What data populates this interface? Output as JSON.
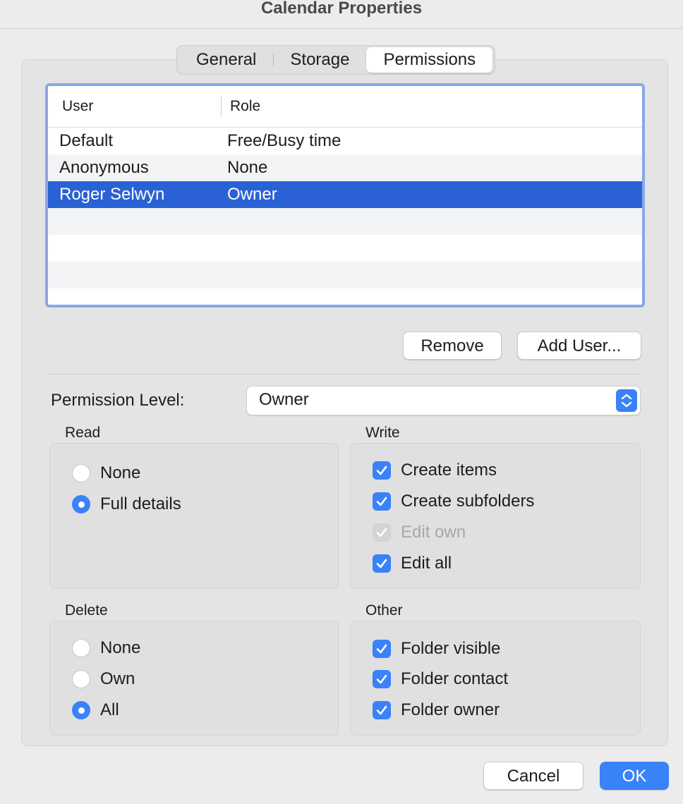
{
  "window": {
    "title": "Calendar Properties"
  },
  "tabs": [
    {
      "label": "General",
      "active": false
    },
    {
      "label": "Storage",
      "active": false
    },
    {
      "label": "Permissions",
      "active": true
    }
  ],
  "users_table": {
    "columns": [
      "User",
      "Role"
    ],
    "rows": [
      {
        "user": "Default",
        "role": "Free/Busy time",
        "selected": false
      },
      {
        "user": "Anonymous",
        "role": "None",
        "selected": false
      },
      {
        "user": "Roger Selwyn",
        "role": "Owner",
        "selected": true
      }
    ]
  },
  "buttons": {
    "remove": "Remove",
    "add_user": "Add User...",
    "cancel": "Cancel",
    "ok": "OK"
  },
  "permission_level": {
    "label": "Permission Level:",
    "value": "Owner"
  },
  "read": {
    "label": "Read",
    "options": [
      {
        "label": "None",
        "selected": false
      },
      {
        "label": "Full details",
        "selected": true
      }
    ]
  },
  "write": {
    "label": "Write",
    "options": [
      {
        "label": "Create items",
        "checked": true,
        "disabled": false
      },
      {
        "label": "Create subfolders",
        "checked": true,
        "disabled": false
      },
      {
        "label": "Edit own",
        "checked": true,
        "disabled": true
      },
      {
        "label": "Edit all",
        "checked": true,
        "disabled": false
      }
    ]
  },
  "delete": {
    "label": "Delete",
    "options": [
      {
        "label": "None",
        "selected": false
      },
      {
        "label": "Own",
        "selected": false
      },
      {
        "label": "All",
        "selected": true
      }
    ]
  },
  "other": {
    "label": "Other",
    "options": [
      {
        "label": "Folder visible",
        "checked": true
      },
      {
        "label": "Folder contact",
        "checked": true
      },
      {
        "label": "Folder owner",
        "checked": true
      }
    ]
  },
  "colors": {
    "accent": "#3a82f7",
    "selection": "#2a62d6",
    "focus_ring": "#8aa7e6"
  }
}
